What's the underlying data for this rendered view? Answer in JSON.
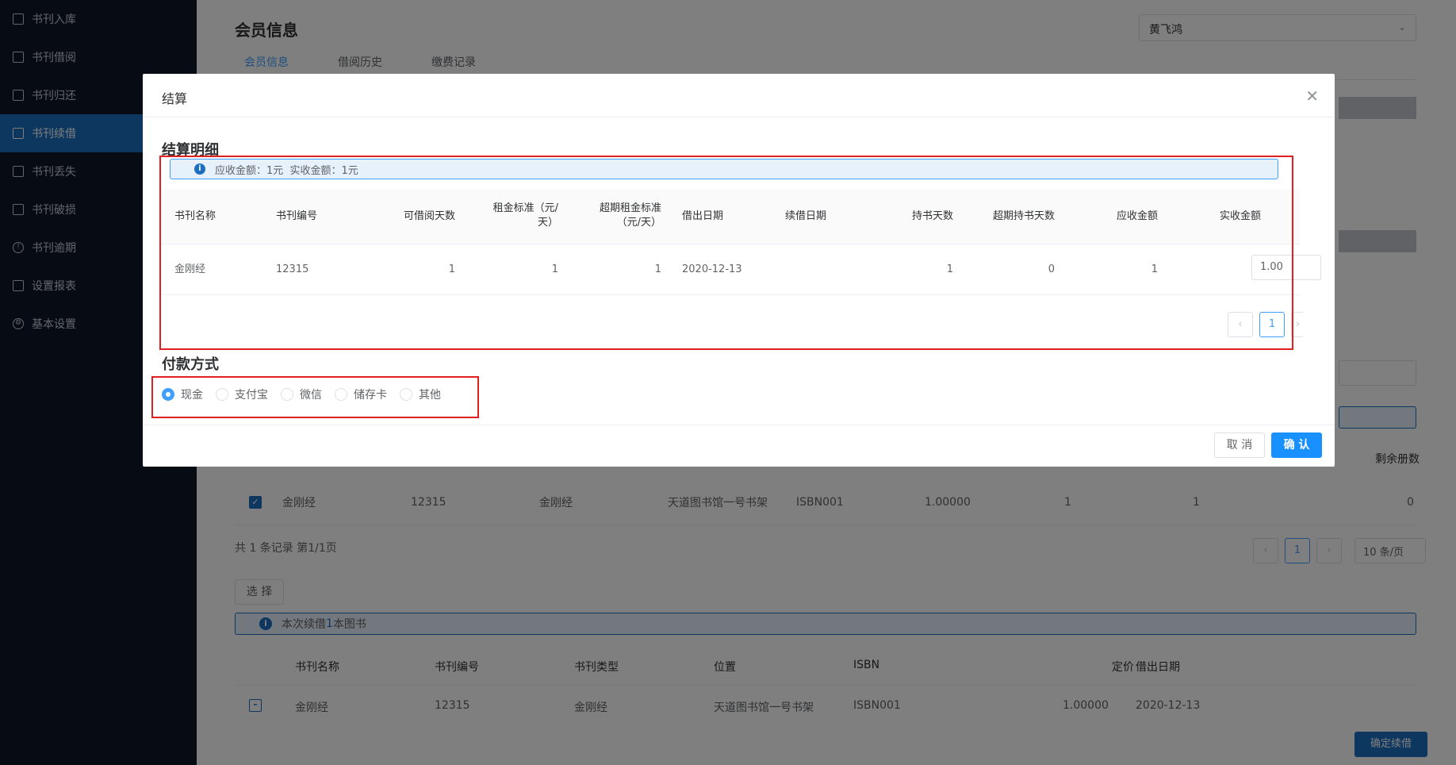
{
  "sidebar": {
    "items": [
      {
        "label": "书刊入库",
        "icon": "import-icon"
      },
      {
        "label": "书刊借阅",
        "icon": "book-icon"
      },
      {
        "label": "书刊归还",
        "icon": "book-icon"
      },
      {
        "label": "书刊续借",
        "icon": "book-icon",
        "active": true
      },
      {
        "label": "书刊丢失",
        "icon": "book-icon"
      },
      {
        "label": "书刊破损",
        "icon": "book-icon"
      },
      {
        "label": "书刊逾期",
        "icon": "clock-icon"
      },
      {
        "label": "设置报表",
        "icon": "report-icon"
      },
      {
        "label": "基本设置",
        "icon": "gear-icon"
      }
    ]
  },
  "main": {
    "title": "会员信息",
    "member_select": "黄飞鸿",
    "tabs": [
      "会员信息",
      "借阅历史",
      "缴费记录"
    ],
    "list": {
      "last_header": "剩余册数",
      "row": [
        "金刚经",
        "12315",
        "金刚经",
        "天道图书馆一号书架",
        "ISBN001",
        "1.00000",
        "1",
        "1",
        "0"
      ]
    },
    "pager": {
      "info": "共 1 条记录 第1/1页",
      "page": "1",
      "page_size": "10 条/页"
    },
    "choose_button": "选 择",
    "renew_info": {
      "prefix": "本次续借 ",
      "count": "1",
      "suffix": " 本图书"
    },
    "renew_table": {
      "headers": [
        "书刊名称",
        "书刊编号",
        "书刊类型",
        "位置",
        "ISBN",
        "定价",
        "借出日期"
      ],
      "row": [
        "金刚经",
        "12315",
        "金刚经",
        "天道图书馆一号书架",
        "ISBN001",
        "1.00000",
        "2020-12-13"
      ]
    },
    "confirm_renew_button": "确定续借"
  },
  "dialog": {
    "title": "结算",
    "detail_title": "结算明细",
    "amount_info": "应收金额：1元  实收金额：1元",
    "headers": [
      "书刊名称",
      "书刊编号",
      "可借阅天数",
      "租金标准（元/天）",
      "超期租金标准（元/天）",
      "借出日期",
      "续借日期",
      "持书天数",
      "超期持书天数",
      "应收金额",
      "实收金额"
    ],
    "row": {
      "name": "金刚经",
      "code": "12315",
      "days": "1",
      "rent": "1",
      "overdue_rent": "1",
      "borrow_date": "2020-12-13",
      "renew_date": "",
      "hold_days": "1",
      "overdue_days": "0",
      "due": "1",
      "received": "1.00"
    },
    "pager": {
      "page": "1"
    },
    "payment_title": "付款方式",
    "payment_options": [
      "现金",
      "支付宝",
      "微信",
      "储存卡",
      "其他"
    ],
    "selected_payment": "现金",
    "cancel_label": "取 消",
    "ok_label": "确 认"
  },
  "colors": {
    "accent": "#409eff",
    "sidebar_bg": "#0e1726",
    "highlight_border": "#e02020"
  }
}
